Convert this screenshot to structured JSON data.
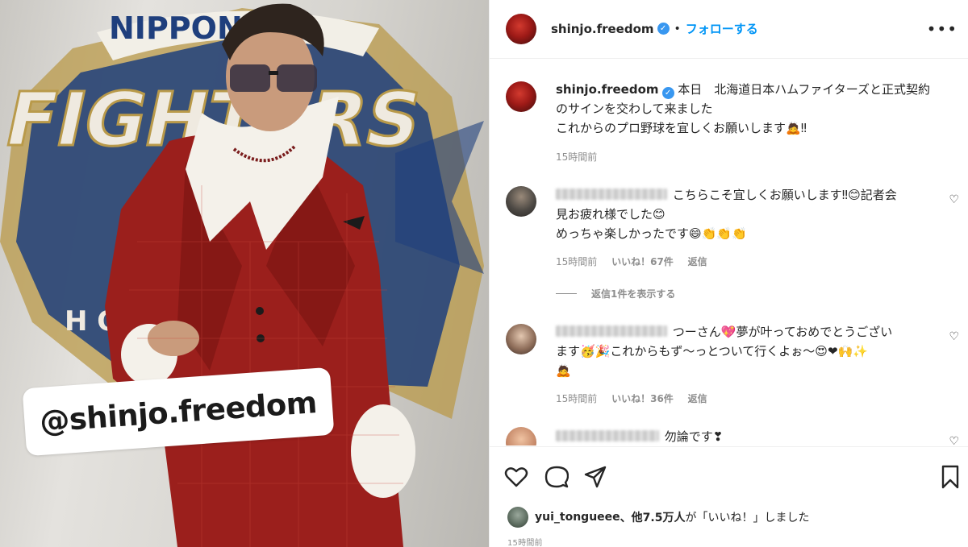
{
  "photo": {
    "sticker_text": "@shinjo.freedom",
    "logo_top": "NIPPON-",
    "logo_main": "FIGHTERS",
    "logo_side": "H O"
  },
  "header": {
    "username": "shinjo.freedom",
    "separator": "•",
    "follow_label": "フォローする",
    "more_label": "•••"
  },
  "caption": {
    "username": "shinjo.freedom",
    "line1": "本日　北海道日本ハムファイターズと正式契約",
    "line2": "のサインを交わして来ました",
    "line3": "これからのプロ野球を宜しくお願いします",
    "line3_emoji": "🙇‼",
    "time": "15時間前"
  },
  "comments": [
    {
      "line1": "こちらこそ宜しくお願いします‼😊記者会",
      "line2": "見お疲れ様でした😊",
      "line3": "めっちゃ楽しかったです😄👏👏👏",
      "time": "15時間前",
      "likes": "いいね！67件",
      "reply": "返信",
      "view_replies": "返信1件を表示する"
    },
    {
      "line1": "つーさん💖夢が叶っておめでとうござい",
      "line2": "ます🥳🎉これからもず〜っとついて行くよぉ〜😍❤🙌✨",
      "line3": "🙇",
      "time": "15時間前",
      "likes": "いいね！36件",
      "reply": "返信"
    },
    {
      "line1": "勿論です❣"
    }
  ],
  "actions": {
    "liked_by_user": "yui_tongueee",
    "liked_by_rest": "、他7.5万人",
    "liked_by_tail": "が「いいね！」しました",
    "time": "15時間前"
  }
}
